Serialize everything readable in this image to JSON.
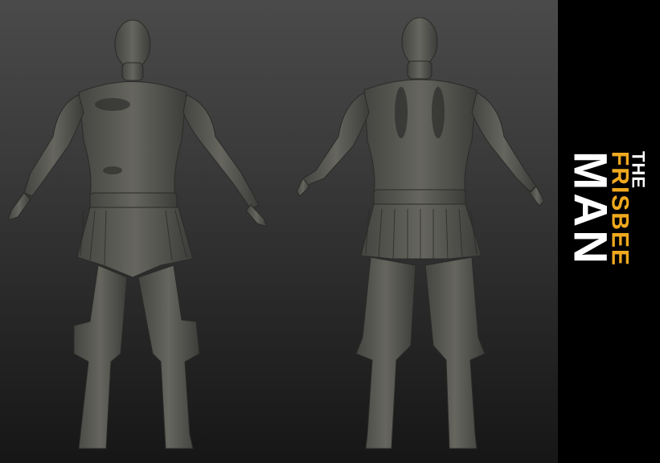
{
  "title_panel": {
    "line1": "THE",
    "line2": "FRISBEE",
    "line3": "MAN"
  },
  "colors": {
    "background_top": "#4a4a4a",
    "background_bottom": "#161616",
    "model_clay": "#5a5a55",
    "accent_orange": "#f0a91e",
    "panel_black": "#000000"
  },
  "views": [
    "front-view",
    "back-view"
  ]
}
